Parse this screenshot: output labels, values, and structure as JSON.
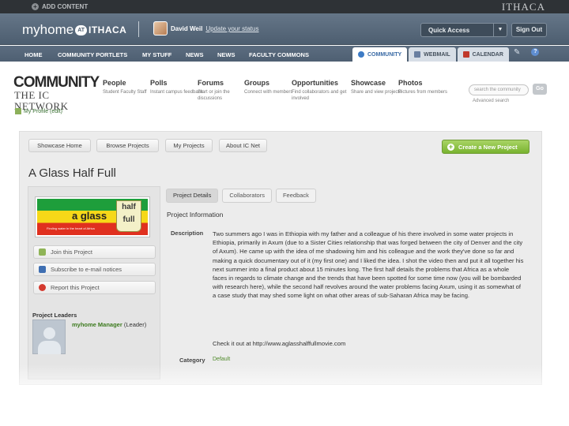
{
  "topbar": {
    "add_content": "ADD CONTENT",
    "brand": "ITHACA"
  },
  "header": {
    "logo_main": "myhome",
    "logo_at": "AT",
    "logo_ithaca": "ITHACA",
    "user_name": "David Weil",
    "user_status_link": "Update your status",
    "quick_access": "Quick Access",
    "sign_out": "Sign Out"
  },
  "nav": {
    "items": [
      "HOME",
      "COMMUNITY PORTLETS",
      "MY STUFF",
      "NEWS",
      "NEWS",
      "FACULTY COMMONS"
    ],
    "tabs": [
      {
        "label": "COMMUNITY",
        "active": true,
        "color": "#3d7bc5"
      },
      {
        "label": "WEBMAIL",
        "active": false,
        "color": "#6a7fa0"
      },
      {
        "label": "CALENDAR",
        "active": false,
        "color": "#c0392b"
      }
    ],
    "settings_icon": "wrench-icon",
    "help_icon": "help-icon"
  },
  "community": {
    "logo_line1": "COMMUNITY",
    "logo_line2": "THE IC NETWORK",
    "my_profile": "My Profile (edit)",
    "links": [
      {
        "title": "People",
        "sub": "Student Faculty Staff"
      },
      {
        "title": "Polls",
        "sub": "Instant campus feedback"
      },
      {
        "title": "Forums",
        "sub": "Start or join the discussions"
      },
      {
        "title": "Groups",
        "sub": "Connect with members"
      },
      {
        "title": "Opportunities",
        "sub": "Find collaborators and get involved"
      },
      {
        "title": "Showcase",
        "sub": "Share and view projects"
      },
      {
        "title": "Photos",
        "sub": "Pictures from members"
      }
    ],
    "search_placeholder": "search the community",
    "search_go": "Go",
    "advanced_search": "Advanced search"
  },
  "showcase": {
    "nav_buttons": [
      "Showcase Home",
      "Browse Projects",
      "My Projects",
      "About IC Net"
    ],
    "create_button": "Create a New Project",
    "project_title": "A Glass Half Full",
    "thumb": {
      "text": "a glass",
      "half": "half",
      "full": "full",
      "tagline": "Finding water in the heart of Africa"
    },
    "actions": [
      {
        "label": "Join this Project",
        "icon": "join-icon",
        "color": "#8fb457"
      },
      {
        "label": "Subscribe to e-mail notices",
        "icon": "mail-icon",
        "color": "#3f6fb2"
      },
      {
        "label": "Report this Project",
        "icon": "report-icon",
        "color": "#d43a2f"
      }
    ],
    "leaders_heading": "Project Leaders",
    "leader_name": "myhome Manager",
    "leader_role": "(Leader)",
    "tabs": [
      {
        "label": "Project Details",
        "active": true
      },
      {
        "label": "Collaborators",
        "active": false
      },
      {
        "label": "Feedback",
        "active": false
      }
    ],
    "info_heading": "Project Information",
    "description_label": "Description",
    "description": "Two summers ago I was in Ethiopia with my father and a colleague of his there involved in some water projects in Ethiopia, primarily in Axum (due to a Sister Cities relationship that was forged between the city of Denver and the city of Axum). He came up with the idea of me shadowing him and his colleague and the work they've done so far and making a quick documentary out of it (my first one) and I liked the idea. I shot the video then and put it all together his next summer into a final product about 15 minutes long. The first half details the problems that Africa as a whole faces in regards to climate change and the trends that have been spotted for some time now (you will be bombarded with research here), while the second half revolves around the water problems facing Axum, using it as somewhat of a case study that may shed some light on what other areas of sub-Saharan Africa may be facing.",
    "check_it_out": "Check it out at http://www.aglasshalffullmovie.com",
    "category_label": "Category",
    "category_value": "Default"
  }
}
